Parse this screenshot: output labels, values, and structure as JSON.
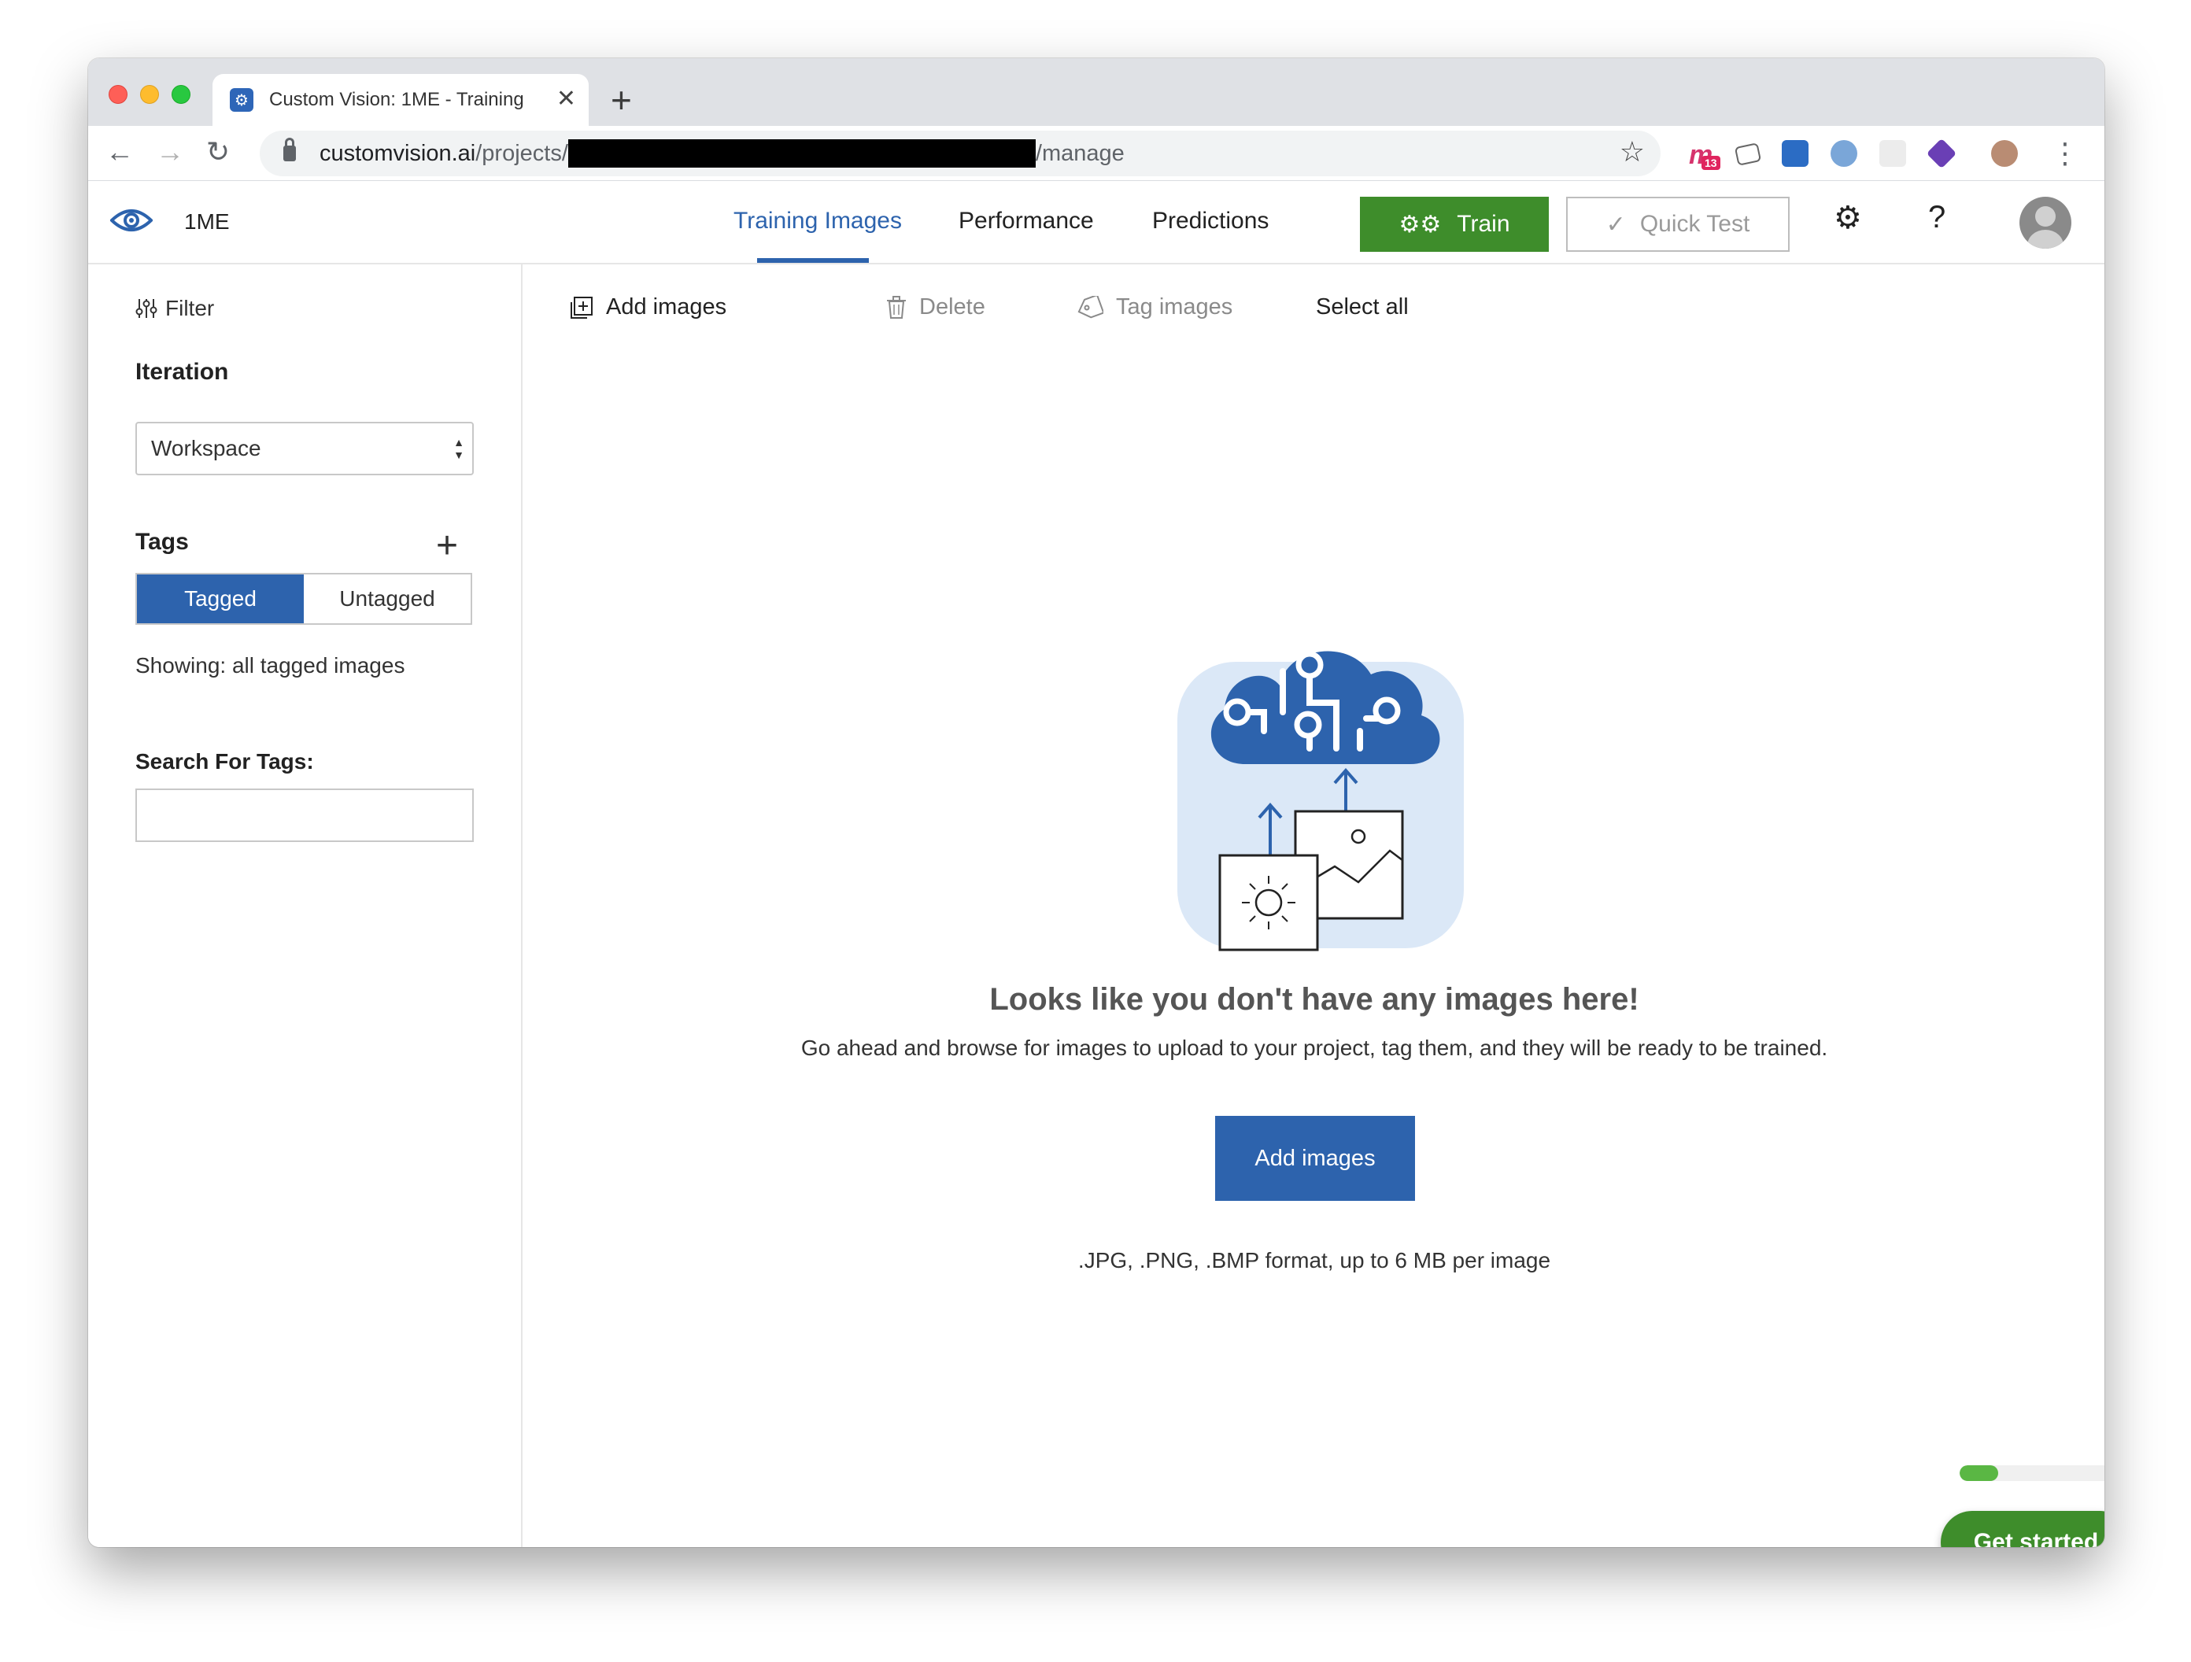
{
  "browser": {
    "tab_title": "Custom Vision: 1ME - Training",
    "tab_close": "✕",
    "new_tab": "+",
    "url_host": "customvision.ai",
    "url_prefix": "/projects/",
    "url_suffix": "/manage",
    "extension_badge": "13"
  },
  "header": {
    "project_name": "1ME",
    "nav": {
      "training_images": "Training Images",
      "performance": "Performance",
      "predictions": "Predictions"
    },
    "train_label": "Train",
    "quick_test_label": "Quick Test",
    "help": "?"
  },
  "sidebar": {
    "filter_label": "Filter",
    "iteration_heading": "Iteration",
    "iteration_selected": "Workspace",
    "tags_heading": "Tags",
    "tagged_label": "Tagged",
    "untagged_label": "Untagged",
    "showing_text": "Showing: all tagged images",
    "search_label": "Search For Tags:",
    "search_value": ""
  },
  "toolbar": {
    "add_images": "Add images",
    "delete": "Delete",
    "tag_images": "Tag images",
    "select_all": "Select all"
  },
  "empty_state": {
    "title": "Looks like you don't have any images here!",
    "subtitle": "Go ahead and browse for images to upload to your project, tag them, and they will be ready to be trained.",
    "button": "Add images",
    "formats": ".JPG, .PNG, .BMP format, up to 6 MB per image"
  },
  "onboarding": {
    "progress_fraction": 0.25,
    "get_started": "Get started"
  },
  "colors": {
    "accent_blue": "#2d63ad",
    "train_green": "#3e8d2b",
    "progress_green": "#5ab744"
  }
}
